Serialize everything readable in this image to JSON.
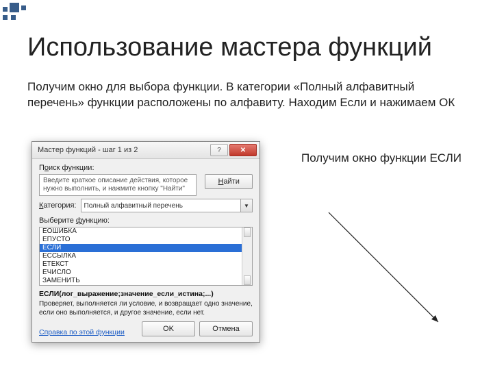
{
  "decor": {},
  "heading": "Использование мастера функций",
  "intro": "Получим окно для выбора функции. В категории «Полный алфавитный перечень» функции расположены по алфавиту. Находим Если и нажимаем ОК",
  "side_text": "Получим окно функции ЕСЛИ",
  "dialog": {
    "title": "Мастер функций - шаг 1 из 2",
    "help_btn": "?",
    "close_btn": "✕",
    "search_label_pre": "П",
    "search_label_u": "о",
    "search_label_post": "иск функции:",
    "search_text": "Введите краткое описание действия, которое нужно выполнить, и нажмите кнопку \"Найти\"",
    "find_u": "Н",
    "find_post": "айти",
    "cat_label_u": "К",
    "cat_label_post": "атегория:",
    "category_value": "Полный алфавитный перечень",
    "select_label_pre": "Выберите ",
    "select_label_u": "ф",
    "select_label_post": "ункцию:",
    "items": {
      "0": "ЕОШИБКА",
      "1": "ЕПУСТО",
      "2": "ЕСЛИ",
      "3": "ЕССЫЛКА",
      "4": "ЕТЕКСТ",
      "5": "ЕЧИСЛО",
      "6": "ЗАМЕНИТЬ"
    },
    "signature": "ЕСЛИ(лог_выражение;значение_если_истина;...)",
    "description": "Проверяет, выполняется ли условие, и возвращает одно значение, если оно выполняется, и другое значение, если нет.",
    "help_link": "Справка по этой функции",
    "ok": "OK",
    "cancel": "Отмена"
  }
}
